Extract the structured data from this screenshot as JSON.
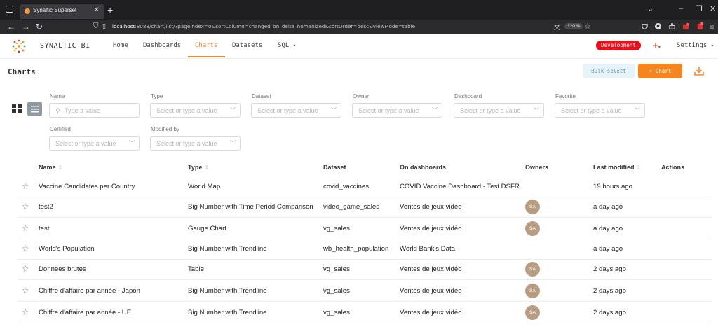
{
  "browser": {
    "tab_title": "Synaltic Superset",
    "url_host": "localhost",
    "url_rest": ":8088/chart/list/?pageIndex=0&sortColumn=changed_on_delta_humanized&sortOrder=desc&viewMode=table",
    "zoom": "120 %"
  },
  "header": {
    "brand": "SYNALTIC BI",
    "nav": [
      "Home",
      "Dashboards",
      "Charts",
      "Datasets",
      "SQL"
    ],
    "active_nav": "Charts",
    "environment": "Development",
    "settings": "Settings",
    "accent": "#f08a2c"
  },
  "page": {
    "title": "Charts",
    "bulk_select": "Bulk select",
    "add_chart": "+ Chart"
  },
  "filters": [
    {
      "label": "Name",
      "placeholder": "Type a value"
    },
    {
      "label": "Type",
      "placeholder": "Select or type a value"
    },
    {
      "label": "Dataset",
      "placeholder": "Select or type a value"
    },
    {
      "label": "Owner",
      "placeholder": "Select or type a value"
    },
    {
      "label": "Dashboard",
      "placeholder": "Select or type a value"
    },
    {
      "label": "Favorite",
      "placeholder": "Select or type a value"
    },
    {
      "label": "Certified",
      "placeholder": "Select or type a value"
    },
    {
      "label": "Modified by",
      "placeholder": "Select or type a value"
    }
  ],
  "table": {
    "columns": [
      "Name",
      "Type",
      "Dataset",
      "On dashboards",
      "Owners",
      "Last modified",
      "Actions"
    ],
    "rows": [
      {
        "name": "Vaccine Candidates per Country",
        "type": "World Map",
        "dataset": "covid_vaccines",
        "dashboards": "COVID Vaccine Dashboard - Test DSFR",
        "owner": "",
        "modified": "19 hours ago"
      },
      {
        "name": "test2",
        "type": "Big Number with Time Period Comparison",
        "dataset": "video_game_sales",
        "dashboards": "Ventes de jeux vidéo",
        "owner": "SA",
        "modified": "a day ago"
      },
      {
        "name": "test",
        "type": "Gauge Chart",
        "dataset": "vg_sales",
        "dashboards": "Ventes de jeux vidéo",
        "owner": "SA",
        "modified": "a day ago"
      },
      {
        "name": "World's Population",
        "type": "Big Number with Trendline",
        "dataset": "wb_health_population",
        "dashboards": "World Bank's Data",
        "owner": "",
        "modified": "a day ago"
      },
      {
        "name": "Données brutes",
        "type": "Table",
        "dataset": "vg_sales",
        "dashboards": "Ventes de jeux vidéo",
        "owner": "SA",
        "modified": "2 days ago"
      },
      {
        "name": "Chiffre d'affaire par année - Japon",
        "type": "Big Number with Trendline",
        "dataset": "vg_sales",
        "dashboards": "Ventes de jeux vidéo",
        "owner": "SA",
        "modified": "2 days ago"
      },
      {
        "name": "Chiffre d'affaire par année - UE",
        "type": "Big Number with Trendline",
        "dataset": "vg_sales",
        "dashboards": "Ventes de jeux vidéo",
        "owner": "SA",
        "modified": "2 days ago"
      }
    ]
  }
}
